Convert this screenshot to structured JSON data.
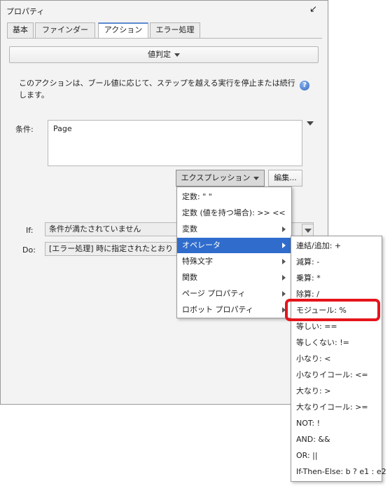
{
  "panel": {
    "title": "プロパティ"
  },
  "tabs": [
    {
      "label": "基本"
    },
    {
      "label": "ファインダー"
    },
    {
      "label": "アクション"
    },
    {
      "label": "エラー処理"
    }
  ],
  "action_select": {
    "value": "値判定"
  },
  "description": "このアクションは、ブール値に応じて、ステップを越える実行を停止または続行します。",
  "condition": {
    "label": "条件:",
    "value": "Page"
  },
  "buttons": {
    "expression": "エクスプレッション",
    "edit": "編集..."
  },
  "if_field": {
    "label": "If:",
    "value": "条件が満たされていません"
  },
  "do_field": {
    "label": "Do:",
    "value": "[エラー処理] 時に指定されたとおり"
  },
  "expression_menu": [
    {
      "label": "定数: \" \"",
      "submenu": false,
      "selected": false
    },
    {
      "label": "定数 (値を持つ場合): >> <<",
      "submenu": false,
      "selected": false
    },
    {
      "label": "変数",
      "submenu": true,
      "selected": false
    },
    {
      "label": "オペレータ",
      "submenu": true,
      "selected": true
    },
    {
      "label": "特殊文字",
      "submenu": true,
      "selected": false
    },
    {
      "label": "関数",
      "submenu": true,
      "selected": false
    },
    {
      "label": "ページ プロパティ",
      "submenu": true,
      "selected": false
    },
    {
      "label": "ロボット プロパティ",
      "submenu": true,
      "selected": false
    }
  ],
  "operator_menu": [
    {
      "label": "連結/追加: +"
    },
    {
      "label": "減算: -"
    },
    {
      "label": "乗算: *"
    },
    {
      "label": "除算: /"
    },
    {
      "label": "モジュール: %"
    },
    {
      "label": "等しい: =="
    },
    {
      "label": "等しくない: !="
    },
    {
      "label": "小なり: <"
    },
    {
      "label": "小なりイコール: <="
    },
    {
      "label": "大なり: >"
    },
    {
      "label": "大なりイコール: >="
    },
    {
      "label": "NOT: !"
    },
    {
      "label": "AND: &&"
    },
    {
      "label": "OR: ||"
    },
    {
      "label": "If-Then-Else: b ? e1 : e2"
    }
  ],
  "colors": {
    "highlight": "#e5151b",
    "menu_selection": "#2f6ccc",
    "active_tab": "#5d8bd0"
  },
  "icons": {
    "pin": "pin-arrow-icon",
    "help": "help-icon"
  }
}
